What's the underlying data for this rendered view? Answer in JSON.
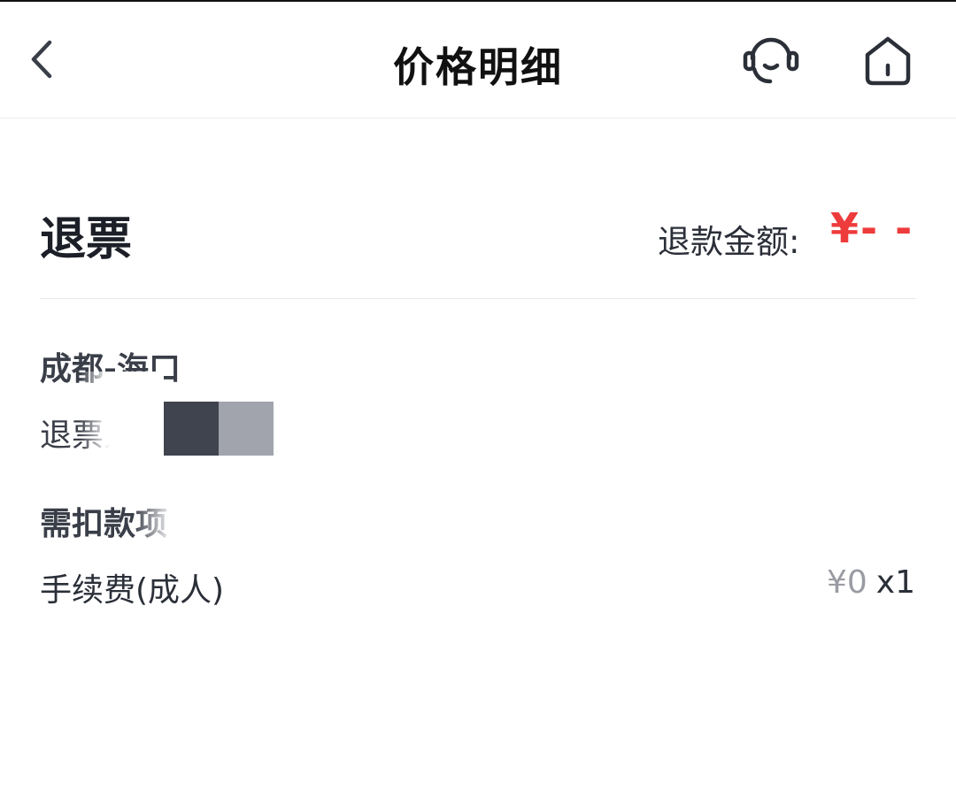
{
  "header": {
    "title": "价格明细",
    "back_icon": "chevron-left-icon",
    "support_icon": "headset-icon",
    "home_icon": "home-icon"
  },
  "refund": {
    "title": "退票",
    "amount_label": "退款金额:",
    "amount_value": "¥- -",
    "amount_color": "#ee3b3b"
  },
  "trip": {
    "route": "成都-海口",
    "passenger_label": "退票人"
  },
  "deductions": {
    "title": "需扣款项",
    "items": [
      {
        "label": "手续费(成人)",
        "price": "¥0",
        "qty": "x1"
      }
    ]
  }
}
